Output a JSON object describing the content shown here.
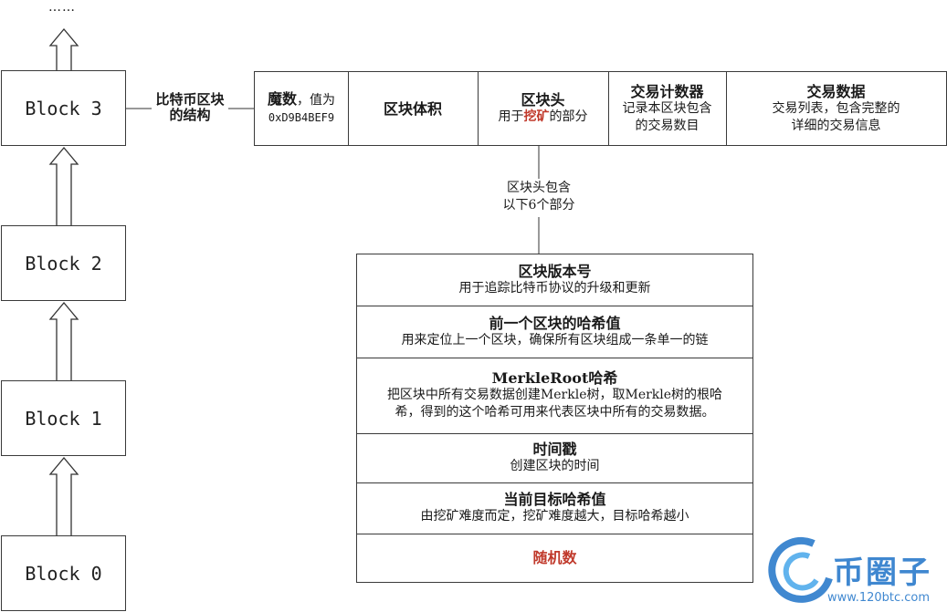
{
  "top_ellipsis": "……",
  "blocks": [
    {
      "label": "Block 3"
    },
    {
      "label": "Block 2"
    },
    {
      "label": "Block 1"
    },
    {
      "label": "Block 0"
    }
  ],
  "structure_label": {
    "line1": "比特币区块",
    "line2": "的结构"
  },
  "block_structure": {
    "magic": {
      "title": "魔数",
      "title_suffix": "，值为",
      "value": "0xD9B4BEF9"
    },
    "size": {
      "title": "区块体积"
    },
    "header": {
      "title": "区块头",
      "desc_prefix": "用于",
      "desc_highlight": "挖矿",
      "desc_suffix": "的部分"
    },
    "tx_counter": {
      "title": "交易计数器",
      "desc_line1": "记录本区块包含",
      "desc_line2": "的交易数目"
    },
    "tx_data": {
      "title": "交易数据",
      "desc_line1": "交易列表，包含完整的",
      "desc_line2": "详细的交易信息"
    }
  },
  "header_note": {
    "line1": "区块头包含",
    "line2": "以下6个部分"
  },
  "header_parts": [
    {
      "title": "区块版本号",
      "desc": "用于追踪比特币协议的升级和更新"
    },
    {
      "title": "前一个区块的哈希值",
      "desc": "用来定位上一个区块，确保所有区块组成一条单一的链"
    },
    {
      "title": "MerkleRoot哈希",
      "desc_line1": "把区块中所有交易数据创建Merkle树，取Merkle树的根哈",
      "desc_line2": "希，得到的这个哈希可用来代表区块中所有的交易数据。"
    },
    {
      "title": "时间戳",
      "desc": "创建区块的时间"
    },
    {
      "title": "当前目标哈希值",
      "desc": "由挖矿难度而定，挖矿难度越大，目标哈希越小"
    },
    {
      "title": "随机数"
    }
  ],
  "watermark": {
    "brand": "币圈子",
    "url": "www.120btc.com"
  },
  "colors": {
    "highlight": "#c0392b",
    "border": "#3a3a3a",
    "watermark_blue": "#1e73c8"
  }
}
